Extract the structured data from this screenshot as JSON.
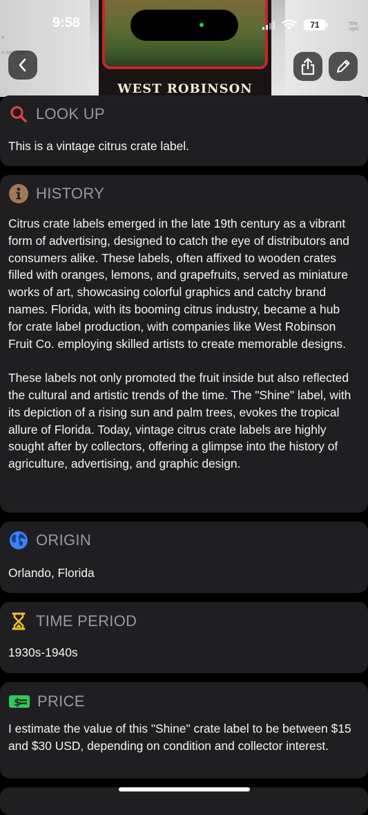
{
  "status_bar": {
    "time": "9:58",
    "battery": "71"
  },
  "hero": {
    "label_brand": "WEST ROBINSON",
    "scrap_left_1": "e",
    "scrap_left_2": "e Antique",
    "scrap_right": "ttle opti"
  },
  "colors": {
    "accent_lookup": "#e8453c",
    "accent_history": "#a07a55",
    "accent_origin": "#3b82f6",
    "accent_time": "#f2c233",
    "accent_price": "#34c759"
  },
  "icons": {
    "back": "chevron-left-icon",
    "share": "share-icon",
    "edit": "pencil-icon",
    "lookup": "search-icon",
    "history": "info-icon",
    "origin": "globe-icon",
    "time": "hourglass-icon",
    "price": "dollar-bill-icon"
  },
  "sections": {
    "lookup": {
      "title": "LOOK UP",
      "body": "This is a vintage citrus crate label."
    },
    "history": {
      "title": "HISTORY",
      "body": "Citrus crate labels emerged in the late 19th century as a vibrant form of advertising, designed to catch the eye of distributors and consumers alike. These labels, often affixed to wooden crates filled with oranges, lemons, and grapefruits, served as miniature works of art, showcasing colorful graphics and catchy brand names. Florida, with its booming citrus industry, became a hub for crate label production, with companies like West Robinson Fruit Co. employing skilled artists to create memorable designs.\n\nThese labels not only promoted the fruit inside but also reflected the cultural and artistic trends of the time. The \"Shine\" label, with its depiction of a rising sun and palm trees, evokes the tropical allure of Florida. Today, vintage citrus crate labels are highly sought after by collectors, offering a glimpse into the history of agriculture, advertising, and graphic design."
    },
    "origin": {
      "title": "ORIGIN",
      "body": "Orlando, Florida"
    },
    "time_period": {
      "title": "TIME PERIOD",
      "body": "1930s-1940s"
    },
    "price": {
      "title": "PRICE",
      "body": "I estimate the value of this \"Shine\" crate label to be between $15 and $30 USD, depending on condition and collector interest."
    }
  }
}
